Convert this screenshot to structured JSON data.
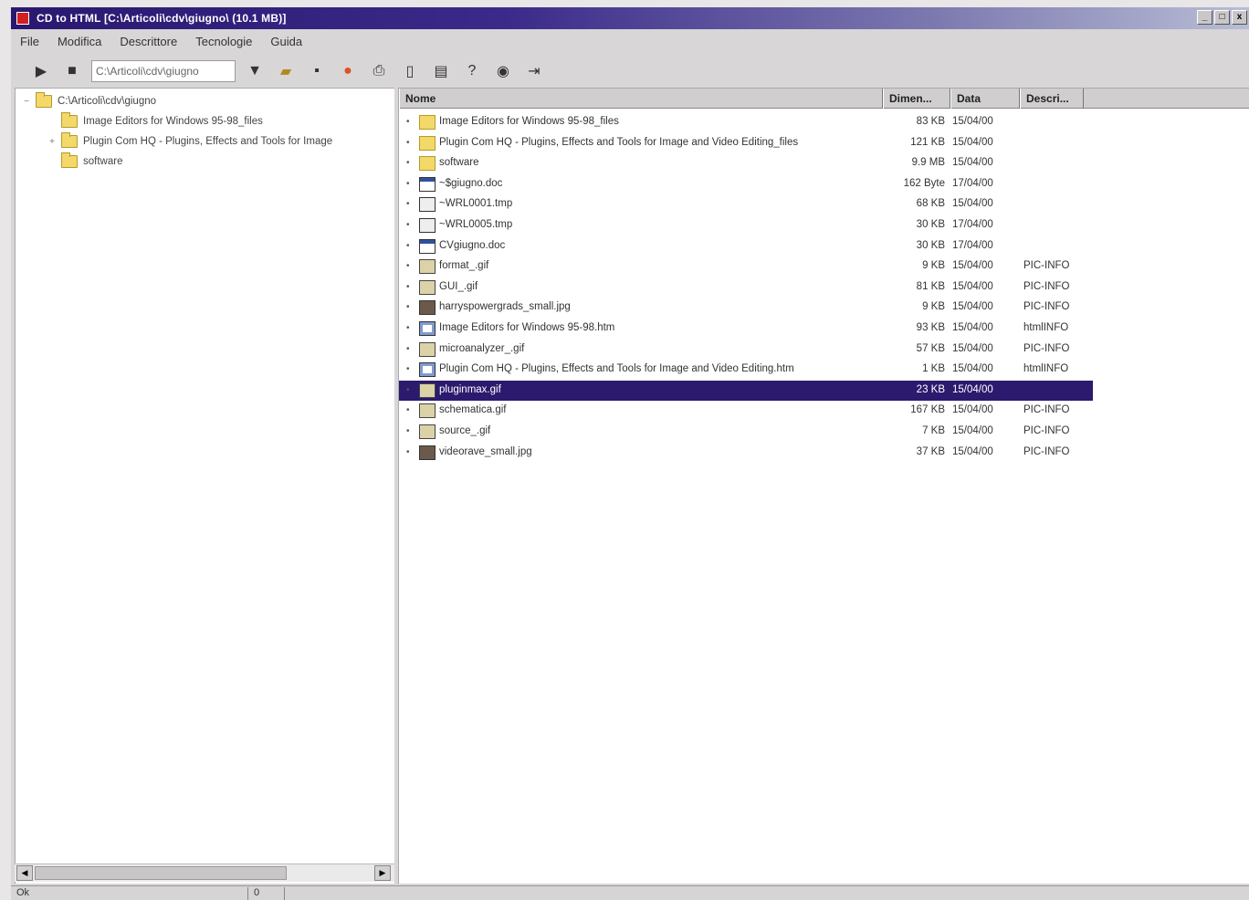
{
  "window": {
    "title": "CD to HTML [C:\\Articoli\\cdv\\giugno\\ (10.1 MB)]",
    "buttons": [
      "_",
      "□",
      "x"
    ]
  },
  "menu": [
    "File",
    "Modifica",
    "Descrittore",
    "Tecnologie",
    "Guida"
  ],
  "toolbar": {
    "path": "C:\\Articoli\\cdv\\giugno"
  },
  "tree": {
    "root": "C:\\Articoli\\cdv\\giugno",
    "items": [
      {
        "label": "Image Editors for Windows 95-98_files",
        "expander": ""
      },
      {
        "label": "Plugin Com HQ - Plugins, Effects and Tools for Image",
        "expander": "+"
      },
      {
        "label": "software",
        "expander": ""
      }
    ]
  },
  "list": {
    "columns": [
      "Nome",
      "Dimen...",
      "Data",
      "Descri..."
    ],
    "rows": [
      {
        "bullet": "•",
        "type": "folder",
        "name": "Image Editors for Windows 95-98_files",
        "size": "83 KB",
        "date": "15/04/00",
        "desc": ""
      },
      {
        "bullet": "•",
        "type": "folder",
        "name": "Plugin Com HQ - Plugins, Effects and Tools for Image and Video Editing_files",
        "size": "121 KB",
        "date": "15/04/00",
        "desc": ""
      },
      {
        "bullet": "•",
        "type": "folder",
        "name": "software",
        "size": "9.9 MB",
        "date": "15/04/00",
        "desc": ""
      },
      {
        "bullet": "•",
        "type": "doc",
        "name": "~$giugno.doc",
        "size": "162 Byte",
        "date": "17/04/00",
        "desc": ""
      },
      {
        "bullet": "•",
        "type": "tmp",
        "name": "~WRL0001.tmp",
        "size": "68 KB",
        "date": "15/04/00",
        "desc": ""
      },
      {
        "bullet": "•",
        "type": "tmp",
        "name": "~WRL0005.tmp",
        "size": "30 KB",
        "date": "17/04/00",
        "desc": ""
      },
      {
        "bullet": "•",
        "type": "doc",
        "name": "CVgiugno.doc",
        "size": "30 KB",
        "date": "17/04/00",
        "desc": ""
      },
      {
        "bullet": "•",
        "type": "gif",
        "name": "format_.gif",
        "size": "9 KB",
        "date": "15/04/00",
        "desc": "PIC-INFO"
      },
      {
        "bullet": "•",
        "type": "gif",
        "name": "GUI_.gif",
        "size": "81 KB",
        "date": "15/04/00",
        "desc": "PIC-INFO"
      },
      {
        "bullet": "•",
        "type": "jpg",
        "name": "harryspowergrads_small.jpg",
        "size": "9 KB",
        "date": "15/04/00",
        "desc": "PIC-INFO"
      },
      {
        "bullet": "•",
        "type": "htm",
        "name": "Image Editors for Windows 95-98.htm",
        "size": "93 KB",
        "date": "15/04/00",
        "desc": "htmlINFO"
      },
      {
        "bullet": "•",
        "type": "gif",
        "name": "microanalyzer_.gif",
        "size": "57 KB",
        "date": "15/04/00",
        "desc": "PIC-INFO"
      },
      {
        "bullet": "•",
        "type": "htm",
        "name": "Plugin Com HQ - Plugins, Effects and Tools for Image and Video Editing.htm",
        "size": "1 KB",
        "date": "15/04/00",
        "desc": "htmlINFO"
      },
      {
        "bullet": "•",
        "type": "gif",
        "name": "pluginmax.gif",
        "size": "23 KB",
        "date": "15/04/00",
        "desc": "",
        "selected": true
      },
      {
        "bullet": "•",
        "type": "gif",
        "name": "schematica.gif",
        "size": "167 KB",
        "date": "15/04/00",
        "desc": "PIC-INFO"
      },
      {
        "bullet": "•",
        "type": "gif",
        "name": "source_.gif",
        "size": "7 KB",
        "date": "15/04/00",
        "desc": "PIC-INFO"
      },
      {
        "bullet": "•",
        "type": "jpg",
        "name": "videorave_small.jpg",
        "size": "37 KB",
        "date": "15/04/00",
        "desc": "PIC-INFO"
      }
    ]
  },
  "status": {
    "left": "Ok",
    "middle": "0"
  },
  "colors": {
    "titlebar": "#2a1870",
    "selection": "#2b1a6e",
    "folder": "#f3d86a"
  }
}
